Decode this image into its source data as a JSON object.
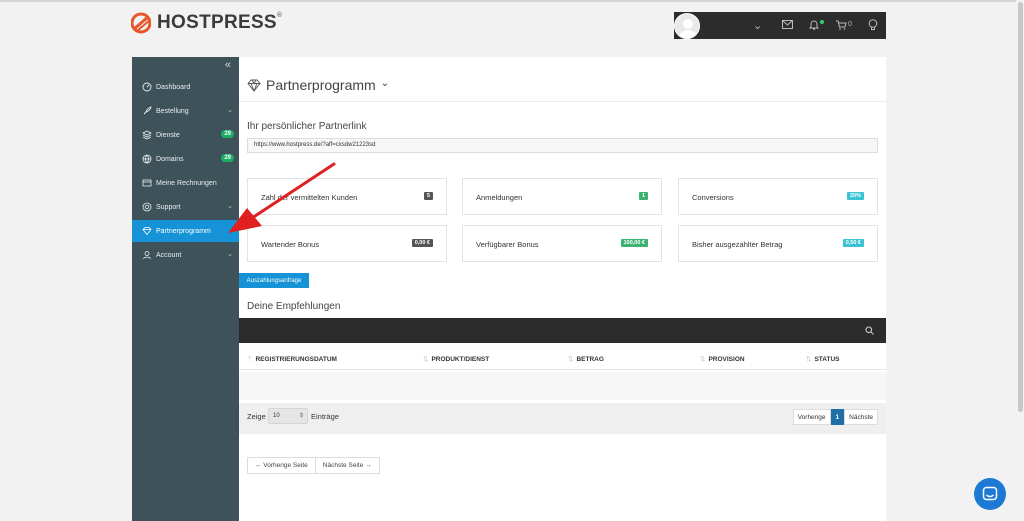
{
  "brand": {
    "name": "HOSTPRESS",
    "reg": "®",
    "accent": "#e8572a"
  },
  "topbar": {
    "cart_count": "0"
  },
  "sidebar": {
    "collapse": "«",
    "items": [
      {
        "label": "Dashboard",
        "icon": "dashboard-icon"
      },
      {
        "label": "Bestellung",
        "icon": "rocket-icon",
        "chevron": "⌄"
      },
      {
        "label": "Dienste",
        "icon": "layers-icon",
        "count": "29"
      },
      {
        "label": "Domains",
        "icon": "globe-icon",
        "count": "29"
      },
      {
        "label": "Meine Rechnungen",
        "icon": "invoice-icon"
      },
      {
        "label": "Support",
        "icon": "lifebuoy-icon",
        "chevron": "⌄"
      },
      {
        "label": "Partnerprogramm",
        "icon": "diamond-icon",
        "active": true
      },
      {
        "label": "Account",
        "icon": "user-icon",
        "chevron": "⌄"
      }
    ]
  },
  "main": {
    "title": "Partnerprogramm",
    "title_chevron": "⌄",
    "link_heading": "Ihr persönlicher Partnerlink",
    "link_value": "https://www.hostpress.de/?aff=cxsdw21223sd",
    "stats": [
      {
        "label": "Zahl der vermittelten Kunden",
        "value": "5",
        "color": "#555555"
      },
      {
        "label": "Anmeldungen",
        "value": "1",
        "color": "#3cb371"
      },
      {
        "label": "Conversions",
        "value": "20%",
        "color": "#3cc3d3"
      },
      {
        "label": "Wartender Bonus",
        "value": "0,00 €",
        "color": "#555555"
      },
      {
        "label": "Verfügbarer Bonus",
        "value": "100,00 €",
        "color": "#3cb371"
      },
      {
        "label": "Bisher ausgezahlter Betrag",
        "value": "0,50 €",
        "color": "#3cc3d3"
      }
    ],
    "payout_button": "Auszahlungsanfrage",
    "referrals_heading": "Deine Empfehlungen",
    "table": {
      "columns": [
        "REGISTRIERUNGSDATUM",
        "PRODUKT/DIENST",
        "BETRAG",
        "PROVISION",
        "STATUS"
      ],
      "show_label": "Zeige",
      "page_size": "10",
      "entries_label": "Einträge",
      "prev": "Vorherige",
      "current_page": "1",
      "next": "Nächste"
    },
    "page_prev": "← Vorherige Seite",
    "page_next": "Nächste Seite →"
  }
}
